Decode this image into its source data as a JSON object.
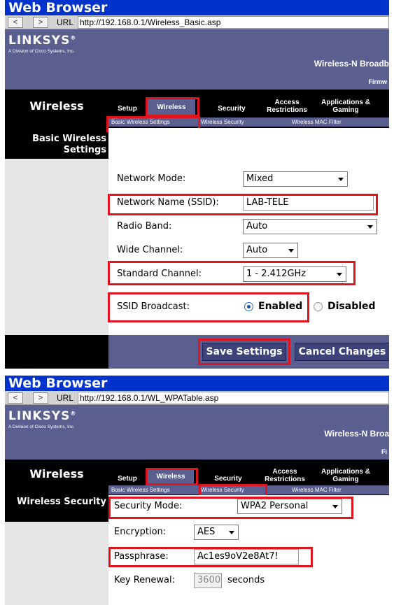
{
  "screenshots": [
    {
      "browser": {
        "title": "Web Browser",
        "back_label": "<",
        "forward_label": ">",
        "url_label": "URL",
        "url": "http://192.168.0.1/Wireless_Basic.asp"
      },
      "header": {
        "logo": "LINKSYS",
        "logo_registered": "®",
        "logo_sub": "A Division of Cisco Systems, Inc.",
        "firmware": "Firmw",
        "product": "Wireless-N Broadb",
        "section": "Wireless"
      },
      "tabs": [
        "Setup",
        "Wireless",
        "Security",
        "Access Restrictions",
        "Applications & Gaming"
      ],
      "active_tab": "Wireless",
      "subtabs": [
        "Basic Wireless Settings",
        "Wireless Security",
        "Wireless MAC Filter"
      ],
      "active_subtab": "Basic Wireless Settings",
      "side_title": "Basic Wireless Settings",
      "form": {
        "network_mode": {
          "label": "Network Mode:",
          "value": "Mixed"
        },
        "ssid": {
          "label": "Network Name (SSID):",
          "value": "LAB-TELE"
        },
        "radio_band": {
          "label": "Radio Band:",
          "value": "Auto"
        },
        "wide_channel": {
          "label": "Wide Channel:",
          "value": "Auto"
        },
        "standard_channel": {
          "label": "Standard Channel:",
          "value": "1 - 2.412GHz"
        },
        "ssid_broadcast": {
          "label": "SSID Broadcast:",
          "enabled_label": "Enabled",
          "disabled_label": "Disabled",
          "selected": "Enabled"
        }
      },
      "buttons": {
        "save": "Save Settings",
        "cancel": "Cancel Changes"
      }
    },
    {
      "browser": {
        "title": "Web Browser",
        "back_label": "<",
        "forward_label": ">",
        "url_label": "URL",
        "url": "http://192.168.0.1/WL_WPATable.asp"
      },
      "header": {
        "logo": "LINKSYS",
        "logo_registered": "®",
        "logo_sub": "A Division of Cisco Systems, Inc.",
        "firmware": "Fi",
        "product": "Wireless-N Broa",
        "section": "Wireless"
      },
      "tabs": [
        "Setup",
        "Wireless",
        "Security",
        "Access Restrictions",
        "Applications & Gaming"
      ],
      "active_tab": "Wireless",
      "subtabs": [
        "Basic Wireless Settings",
        "Wireless Security",
        "Wireless MAC Filter"
      ],
      "active_subtab": "Wireless Security",
      "side_title": "Wireless Security",
      "form": {
        "security_mode": {
          "label": "Security Mode:",
          "value": "WPA2 Personal"
        },
        "encryption": {
          "label": "Encryption:",
          "value": "AES"
        },
        "passphrase": {
          "label": "Passphrase:",
          "value": "Ac1es9oV2e8At7!"
        },
        "key_renewal": {
          "label": "Key Renewal:",
          "value": "3600",
          "unit": "seconds"
        }
      }
    }
  ],
  "colors": {
    "browser_title": "#0033cc",
    "brand": "#5b5f8f",
    "highlight": "#e0141e"
  }
}
